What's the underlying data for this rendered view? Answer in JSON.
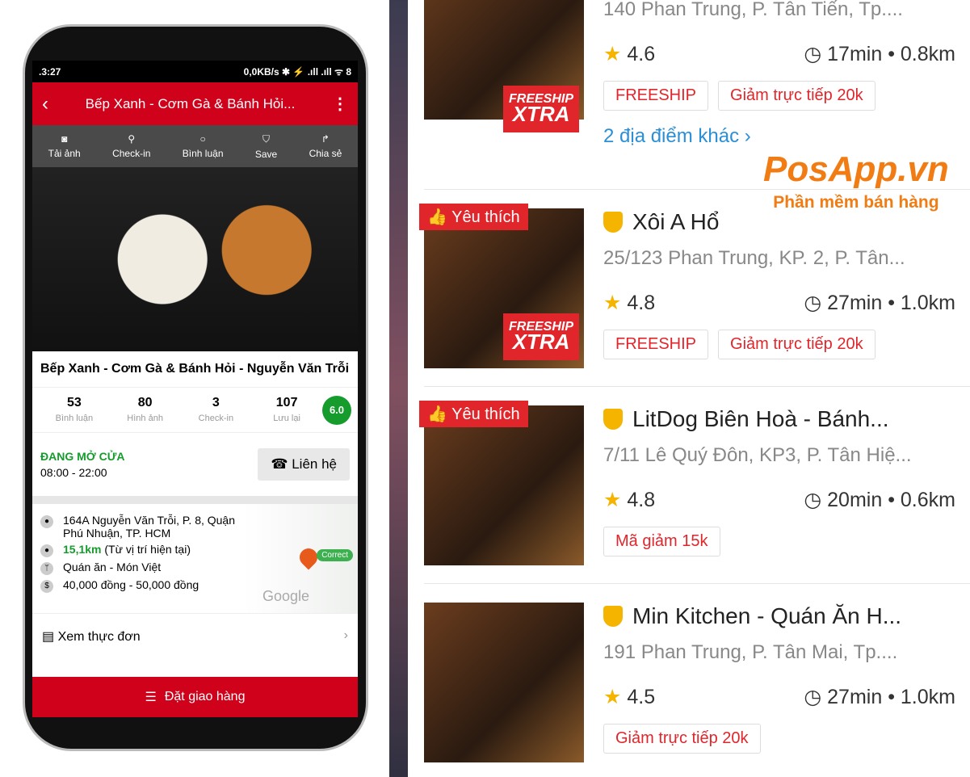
{
  "phone": {
    "status": {
      "time": ".3:27",
      "right": "0,0KB/s ✱ ⚡ .ıll .ıll ᯤ 8"
    },
    "title": "Bếp Xanh - Cơm Gà & Bánh Hỏi...",
    "toolbar": [
      {
        "icon": "camera-icon",
        "label": "Tải ảnh"
      },
      {
        "icon": "map-pin-icon",
        "label": "Check-in"
      },
      {
        "icon": "comment-icon",
        "label": "Bình luận"
      },
      {
        "icon": "bookmark-icon",
        "label": "Save"
      },
      {
        "icon": "share-icon",
        "label": "Chia sẻ"
      }
    ],
    "name": "Bếp Xanh - Cơm Gà & Bánh Hỏi - Nguyễn Văn Trỗi",
    "stats": [
      {
        "v": "53",
        "l": "Bình luận"
      },
      {
        "v": "80",
        "l": "Hình ảnh"
      },
      {
        "v": "3",
        "l": "Check-in"
      },
      {
        "v": "107",
        "l": "Lưu lại"
      }
    ],
    "score": "6.0",
    "open_status": "ĐANG MỞ CỬA",
    "hours": "08:00 - 22:00",
    "contact": "Liên hệ",
    "address": "164A Nguyễn Văn Trỗi, P. 8, Quận Phú Nhuận, TP. HCM",
    "distance": "15,1km",
    "distance_note": "(Từ vị trí hiện tại)",
    "category": "Quán ăn - Món Việt",
    "price": "40,000 đồng - 50,000 đồng",
    "map_badge": "Correct",
    "map_brand": "Google",
    "menu": "Xem thực đơn",
    "order": "Đặt giao hàng"
  },
  "list": {
    "items": [
      {
        "name": "",
        "addr": "140 Phan Trung, P. Tân Tiến, Tp....",
        "rating": "4.6",
        "time": "17min",
        "dist": "0.8km",
        "tags": [
          "FREESHIP",
          "Giảm trực tiếp 20k"
        ],
        "more": "2 địa điểm khác ›",
        "fav": "",
        "xtra": true
      },
      {
        "name": "Xôi A Hổ",
        "addr": "25/123 Phan Trung, KP. 2, P. Tân...",
        "rating": "4.8",
        "time": "27min",
        "dist": "1.0km",
        "tags": [
          "FREESHIP",
          "Giảm trực tiếp 20k"
        ],
        "fav": "Yêu thích",
        "xtra": true
      },
      {
        "name": "LitDog Biên Hoà - Bánh...",
        "addr": "7/11 Lê Quý Đôn, KP3, P. Tân Hiệ...",
        "rating": "4.8",
        "time": "20min",
        "dist": "0.6km",
        "tags": [
          "Mã giảm 15k"
        ],
        "fav": "Yêu thích",
        "xtra": false
      },
      {
        "name": "Min Kitchen - Quán Ăn H...",
        "addr": "191 Phan Trung, P. Tân Mai, Tp....",
        "rating": "4.5",
        "time": "27min",
        "dist": "1.0km",
        "tags": [
          "Giảm trực tiếp 20k"
        ],
        "fav": "",
        "xtra": false
      }
    ],
    "xtra_top": "FREESHIP",
    "xtra_bottom": "XTRA"
  },
  "watermark": {
    "logo": "PosApp.vn",
    "tagline": "Phần mềm bán hàng"
  },
  "colors": {
    "brand_red": "#d0021b",
    "green": "#159c2c",
    "tag_red": "#e0262b",
    "star": "#f5b400",
    "watermark": "#f07c13"
  }
}
